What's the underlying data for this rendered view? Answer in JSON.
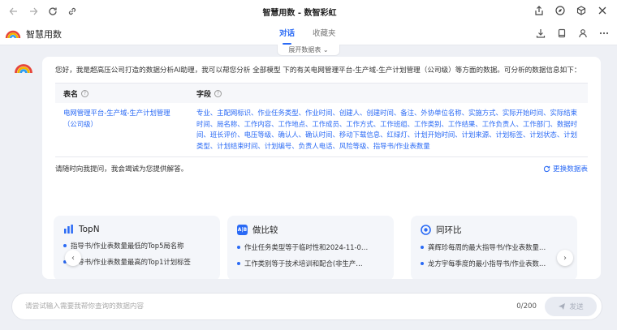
{
  "browser": {
    "title": "智慧用数 - 数智彩虹"
  },
  "header": {
    "app_name": "智慧用数",
    "tabs": [
      {
        "label": "对话",
        "active": true
      },
      {
        "label": "收藏夹",
        "active": false
      }
    ],
    "expand_label": "展开数据表"
  },
  "message": {
    "intro": "您好，我是超高压公司打造的数据分析AI助理，我可以帮您分析 全部模型 下的有关电网管理平台-生产域-生产计划管理（公司级）等方面的数据。可分析的数据信息如下：",
    "table": {
      "col_name": "表名",
      "col_fields": "字段",
      "rows": [
        {
          "name": "电网管理平台-生产域-生产计划管理（公司级）",
          "fields": "专业、主配网标识、作业任务类型、作业时间、创建人、创建时间、备注、外协单位名称、实施方式、实际开始时间、实际结束时间、局名称、工作内容、工作地点、工作成员、工作方式、工作班组、工作类别、工作结果、工作负责人、工作部门、数据时间、班长评价、电压等级、确认人、确认时间、移动下载信息、红绿灯、计划开始时间、计划来源、计划标签、计划状态、计划类型、计划结束时间、计划编号、负责人电话、风险等级、指导书/作业表数量"
        }
      ]
    },
    "ask_prompt": "请随时向我提问，我会竭诚为您提供解答。",
    "change_source": "更换数据表"
  },
  "suggestions": [
    {
      "title": "TopN",
      "icon": "bar-chart-icon",
      "color": "#2a6af5",
      "items": [
        "指导书/作业表数量最低的Top5局名称",
        "指导书/作业表数量最高的Top1计划标签"
      ]
    },
    {
      "title": "做比较",
      "icon": "compare-icon",
      "color": "#2a6af5",
      "items": [
        "作业任务类型等于临时性和2024-11-0…",
        "工作类别等于技术培训和配合(非生产…"
      ]
    },
    {
      "title": "同环比",
      "icon": "target-icon",
      "color": "#2a6af5",
      "items": [
        "龚辉珍每周的最大指导书/作业表数量…",
        "龙方宇每季度的最小指导书/作业表数…"
      ]
    }
  ],
  "input": {
    "placeholder": "请尝试输入需要我帮你查询的数据内容",
    "counter": "0/200",
    "send_label": "发送"
  },
  "colors": {
    "accent": "#2a6af5",
    "background": "#eef0f5"
  }
}
